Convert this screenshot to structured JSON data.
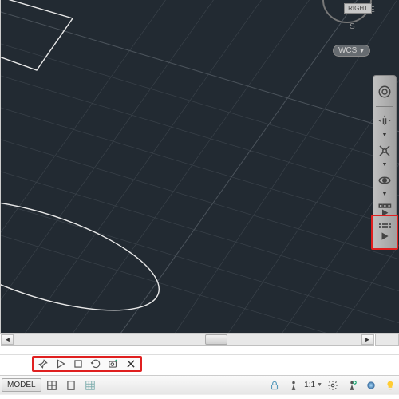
{
  "viewcube": {
    "face": "RIGHT",
    "wcs": "WCS",
    "compass_s": "S",
    "compass_e": "E"
  },
  "nav_bar": {
    "tools": [
      {
        "name": "nav-wheel",
        "icon": "steering-wheel"
      },
      {
        "name": "pan",
        "icon": "hand"
      },
      {
        "name": "zoom-extents",
        "icon": "zoom-extents"
      },
      {
        "name": "orbit",
        "icon": "orbit"
      },
      {
        "name": "show-motion",
        "icon": "show-motion"
      }
    ]
  },
  "highlighted_shotglass": {
    "name": "show-motion-play"
  },
  "anim_toolbar": {
    "tools": [
      {
        "name": "pin",
        "icon": "pin"
      },
      {
        "name": "play",
        "icon": "play"
      },
      {
        "name": "stop",
        "icon": "stop"
      },
      {
        "name": "loop",
        "icon": "loop"
      },
      {
        "name": "new-shot",
        "icon": "camera"
      },
      {
        "name": "close",
        "icon": "close"
      }
    ]
  },
  "status": {
    "model": "MODEL",
    "ratio": "1:1",
    "buttons": [
      {
        "name": "layout-grid",
        "icon": "grid"
      },
      {
        "name": "layout-page",
        "icon": "page"
      },
      {
        "name": "grid-display",
        "icon": "grid3"
      },
      {
        "name": "snap",
        "icon": "snap"
      },
      {
        "name": "constraints",
        "icon": "lock"
      },
      {
        "name": "annotate-scale",
        "icon": "human"
      },
      {
        "name": "scale-ratio",
        "icon": "ratio"
      },
      {
        "name": "annotate-settings",
        "icon": "gear"
      },
      {
        "name": "visual-styles",
        "icon": "sphere"
      },
      {
        "name": "layers",
        "icon": "bulb"
      }
    ]
  }
}
